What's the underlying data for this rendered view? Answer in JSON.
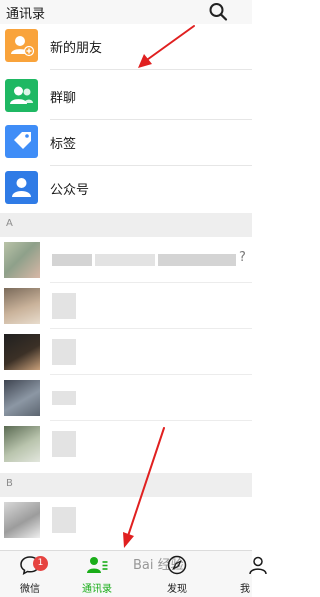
{
  "header": {
    "title": "通讯录"
  },
  "functions": [
    {
      "label": "新的朋友",
      "icon": "add-friend-icon",
      "color": "#f9a33b"
    },
    {
      "label": "群聊",
      "icon": "group-chat-icon",
      "color": "#1fb863"
    },
    {
      "label": "标签",
      "icon": "tag-icon",
      "color": "#3f8df7"
    },
    {
      "label": "公众号",
      "icon": "official-account-icon",
      "color": "#2f7be6"
    }
  ],
  "sections": [
    {
      "letter": "A"
    },
    {
      "letter": "B"
    }
  ],
  "contacts_trailing_char": "?",
  "tabbar": {
    "items": [
      {
        "label": "微信",
        "icon": "chat-bubble-icon"
      },
      {
        "label": "通讯录",
        "icon": "contacts-icon"
      },
      {
        "label": "发现",
        "icon": "compass-icon"
      },
      {
        "label": "我",
        "icon": "me-icon"
      }
    ],
    "badge": "1",
    "active_color": "#1aad19",
    "inactive_color": "#1a1a1a"
  },
  "watermark": "Bai 经验"
}
